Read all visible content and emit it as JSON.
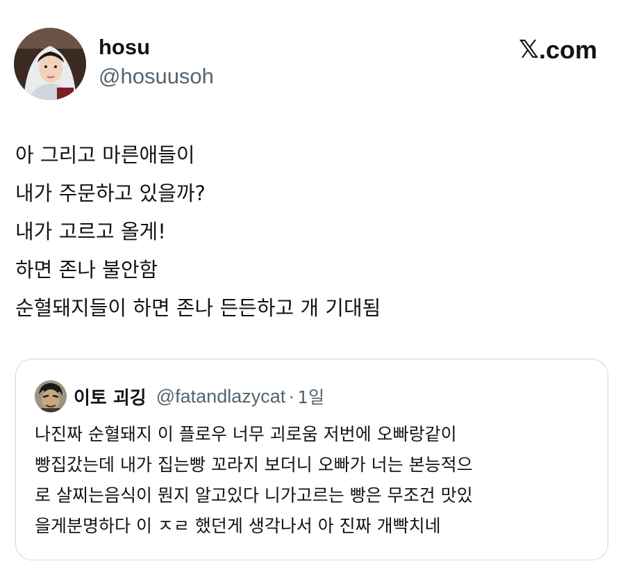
{
  "author": {
    "display_name": "hosu",
    "handle": "@hosuusoh",
    "avatar_icon": "profile-photo"
  },
  "brand": {
    "x_glyph": "𝕏",
    "domain": ".com"
  },
  "tweet": {
    "lines": [
      "아 그리고 마른애들이",
      "내가 주문하고 있을까?",
      "내가 고르고 올게!",
      "하면 존나 불안함",
      "순혈돼지들이 하면 존나 든든하고 개 기대됨"
    ]
  },
  "quote": {
    "display_name": "이토 괴깅",
    "handle": "@fatandlazycat",
    "separator": "·",
    "time": "1일",
    "avatar_icon": "comic-character-avatar",
    "lines": [
      "나진짜 순혈돼지 이 플로우 너무 괴로움 저번에 오빠랑같이",
      "빵집갔는데 내가 집는빵 꼬라지 보더니 오빠가 너는 본능적으",
      "로 살찌는음식이 뭔지 알고있다 니가고르는 빵은 무조건 맛있",
      "을게분명하다 이 ㅈㄹ 했던게 생각나서 아 진짜 개빡치네"
    ]
  },
  "colors": {
    "text": "#0f1419",
    "secondary_text": "#536471",
    "border": "#cfd9de",
    "background": "#ffffff"
  }
}
